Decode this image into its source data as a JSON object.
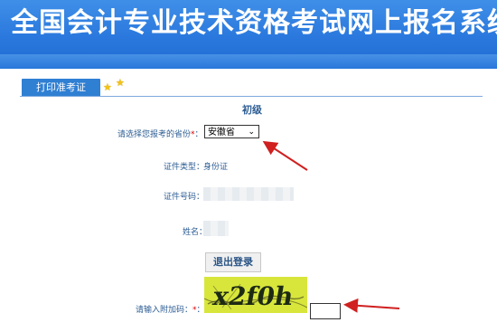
{
  "banner": {
    "title": "全国会计专业技术资格考试网上报名系统"
  },
  "tab": {
    "label": "打印准考证"
  },
  "level": "初级",
  "province": {
    "label": "请选择您报考的省份",
    "required": "*",
    "colon": "：",
    "value": "安徽省"
  },
  "id_type": {
    "label": "证件类型：",
    "value": "身份证"
  },
  "id_number": {
    "label": "证件号码："
  },
  "name": {
    "label": "姓名："
  },
  "logout_button": "退出登录",
  "captcha": {
    "label": "请输入附加码：",
    "required": "*",
    "colon": "：",
    "text": "x2f0h"
  },
  "colors": {
    "banner": "#2a78dd",
    "tab": "#2f7fd3",
    "label": "#2e5e94",
    "arrow": "#d02020",
    "captcha_bg": "#d8e63c"
  }
}
